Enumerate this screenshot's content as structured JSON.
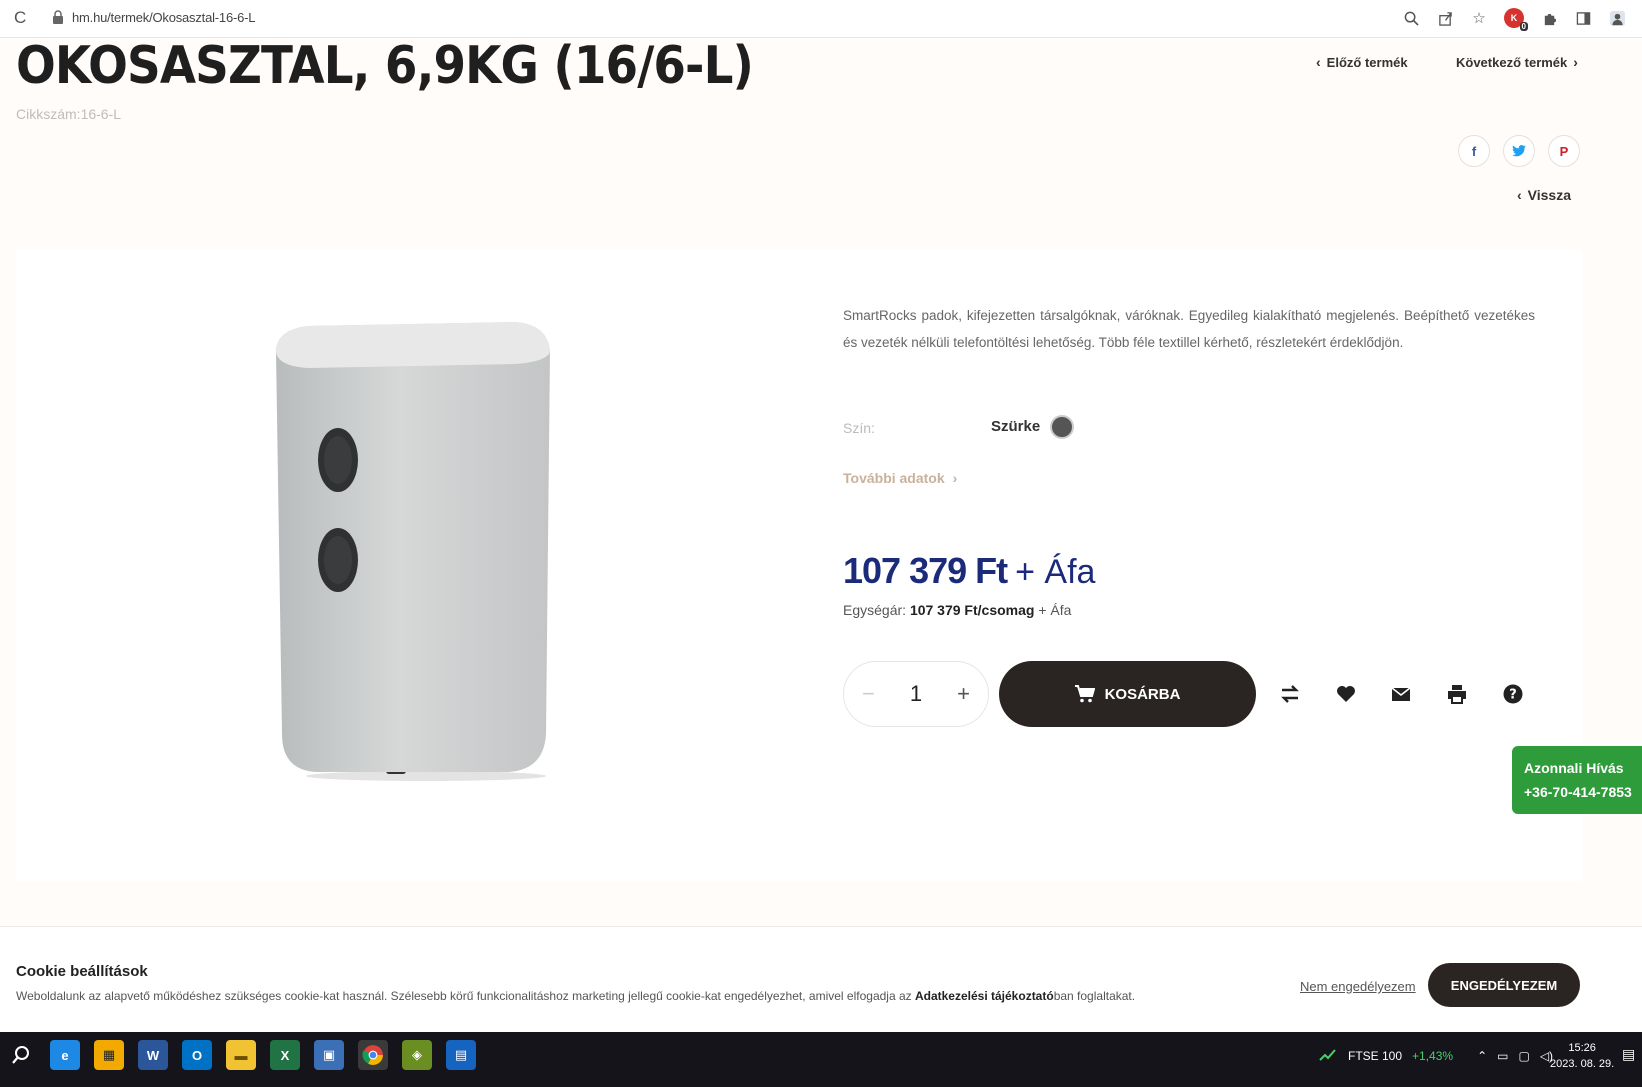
{
  "browser": {
    "url": "hm.hu/termek/Okosasztal-16-6-L",
    "extension_badge": "K",
    "extension_count": "0"
  },
  "product": {
    "title": "OKOSASZTAL, 6,9KG (16/6-L)",
    "sku_label": "Cikkszám:",
    "sku": "16-6-L",
    "description": "SmartRocks padok, kifejezetten társalgóknak, váróknak. Egyedileg kialakítható megjelenés. Beépíthető vezetékes és vezeték nélküli telefontöltési lehetőség. Több féle textillel kérhető, részletekért érdeklődjön.",
    "color_label": "Szín:",
    "color_value": "Szürke",
    "color_hex": "#555555",
    "more_data": "További adatok",
    "price": "107 379 Ft",
    "vat_suffix": "+ Áfa",
    "unit_price_label": "Egységár:",
    "unit_price": "107 379 Ft/csomag",
    "unit_vat": "+ Áfa",
    "quantity": "1",
    "add_to_cart": "KOSÁRBA"
  },
  "nav": {
    "prev": "Előző termék",
    "next": "Következő termék",
    "back": "Vissza"
  },
  "call": {
    "label": "Azonnali Hívás",
    "phone": "+36-70-414-7853"
  },
  "cookie": {
    "title": "Cookie beállítások",
    "text_before": "Weboldalunk az alapvető működéshez szükséges cookie-kat használ. Szélesebb körű funkcionalitáshoz marketing jellegű cookie-kat engedélyezhet, amivel elfogadja az ",
    "text_link": "Adatkezelési tájékoztató",
    "text_after": "ban foglaltakat.",
    "decline": "Nem engedélyezem",
    "accept": "ENGEDÉLYEZEM"
  },
  "taskbar": {
    "ftse_label": "FTSE 100",
    "ftse_change": "+1,43%",
    "time": "15:26",
    "date": "2023. 08. 29."
  },
  "colors": {
    "price_blue": "#1c2a7a",
    "dark_button": "#2a2522",
    "call_green": "#2e9c3a"
  }
}
